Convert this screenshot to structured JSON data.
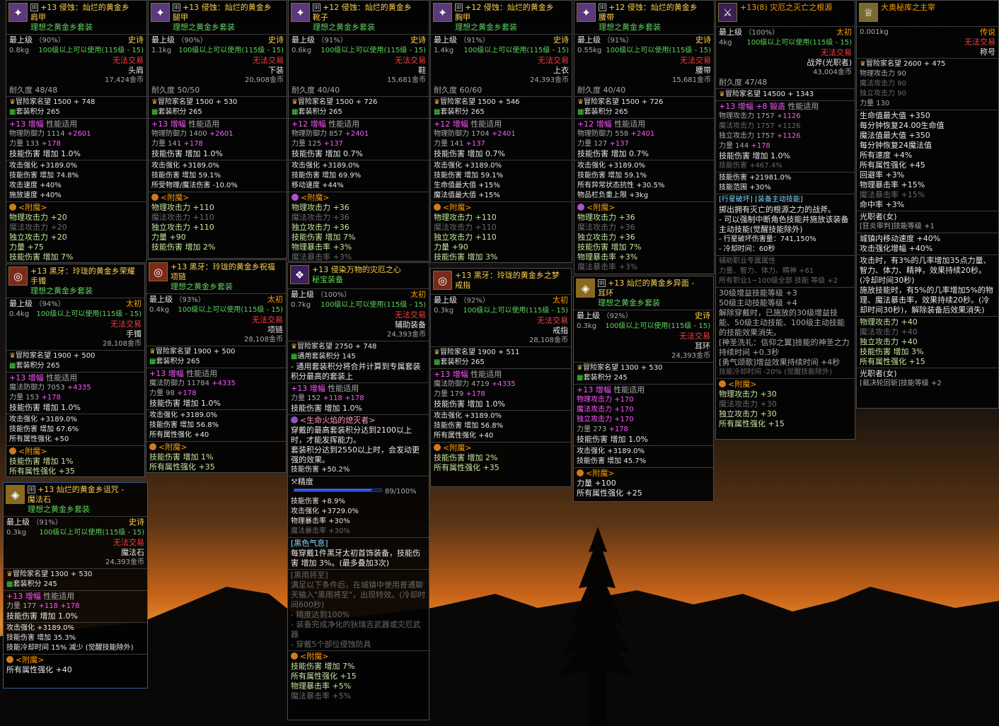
{
  "colors": {
    "epic": "#ffd24a",
    "legend": "#ff9d00",
    "set": "#5fd35f",
    "amp": "#ff55ff",
    "untradeable": "#ff3b3b",
    "sky_top": "#0d0d0f",
    "horizon": "#d9781a"
  },
  "t1": {
    "icon": "shoulder-armor-icon",
    "prefix": "+13 侵蚀：灿烂的黄金乡",
    "name": "肩甲",
    "set": "理想之黄金乡套装",
    "max": "最上级",
    "pct": "（90%）",
    "rarity": "史诗",
    "wt": "0.8kg",
    "req": "100级以上可以使用(115级 - 15)",
    "trade": "无法交易",
    "slot": "头肩",
    "price": "17,424金币",
    "dur": "耐久度 48/48",
    "fame": "冒险家名望 1500 + 748",
    "setscore": "套装积分 265",
    "amp_lv": "+13",
    "amp": "增幅",
    "amp_type": "性能适用",
    "a1": "物理防御力 1114",
    "a1b": "+2601",
    "a2": "力量 133",
    "a2b": "+178",
    "a3": "技能伤害 增加 1.0%",
    "b1": "攻击强化 +3189.0%",
    "b2": "技能伤害 增加 74.8%",
    "b3": "攻击速度 +40%",
    "b4": "施放速度 +40%",
    "ench": "<附魔>",
    "e1": "物理攻击力 +20",
    "e2": "魔法攻击力 +20",
    "e3": "独立攻击力 +20",
    "e4": "力量 +75",
    "e5": "技能伤害 增加 7%"
  },
  "t2": {
    "icon": "leg-armor-icon",
    "prefix": "+13 侵蚀：灿烂的黄金乡",
    "name": "腿甲",
    "set": "理想之黄金乡套装",
    "max": "最上级",
    "pct": "（90%）",
    "rarity": "史诗",
    "wt": "1.1kg",
    "req": "100级以上可以使用(115级 - 15)",
    "trade": "无法交易",
    "slot": "下装",
    "price": "20,908金币",
    "dur": "耐久度 50/50",
    "fame": "冒险家名望 1500 + 530",
    "setscore": "套装积分 265",
    "amp_lv": "+13",
    "amp": "增幅",
    "amp_type": "性能适用",
    "a1": "物理防御力 1400",
    "a1b": "+2601",
    "a2": "力量 141",
    "a2b": "+178",
    "a3": "技能伤害 增加 1.0%",
    "b1": "攻击强化 +3189.0%",
    "b2": "技能伤害 增加 59.1%",
    "b3": "所受物理/魔法伤害 -10.0%",
    "ench": "<附魔>",
    "e1": "物理攻击力 +110",
    "e2": "魔法攻击力 +110",
    "e3": "独立攻击力 +110",
    "e4": "力量 +90",
    "e5": "技能伤害 增加 2%"
  },
  "t3": {
    "icon": "shoes-icon",
    "prefix": "+12 侵蚀：灿烂的黄金乡",
    "name": "靴子",
    "set": "理想之黄金乡套装",
    "max": "最上级",
    "pct": "（91%）",
    "rarity": "史诗",
    "wt": "0.6kg",
    "req": "100级以上可以使用(115级 - 15)",
    "trade": "无法交易",
    "slot": "鞋",
    "price": "15,681金币",
    "dur": "耐久度 40/40",
    "fame": "冒险家名望 1500 + 726",
    "setscore": "套装积分 265",
    "amp_lv": "+12",
    "amp": "增幅",
    "amp_type": "性能适用",
    "a1": "物理防御力 857",
    "a1b": "+2401",
    "a2": "力量 125",
    "a2b": "+137",
    "a3": "技能伤害 增加 0.7%",
    "b1": "攻击强化 +3189.0%",
    "b2": "技能伤害 增加 69.9%",
    "b3": "移动速度 +44%",
    "ench": "<附魔>",
    "e1": "物理攻击力 +36",
    "e2": "魔法攻击力 +36",
    "e3": "独立攻击力 +36",
    "e4": "技能伤害 增加 7%",
    "e5": "物理暴击率 +3%",
    "e6": "魔法暴击率 +3%"
  },
  "t4": {
    "icon": "chest-armor-icon",
    "prefix": "+12 侵蚀：灿烂的黄金乡",
    "name": "胸甲",
    "set": "理想之黄金乡套装",
    "max": "最上级",
    "pct": "（91%）",
    "rarity": "史诗",
    "wt": "1.4kg",
    "req": "100级以上可以使用(115级 - 15)",
    "trade": "无法交易",
    "slot": "上衣",
    "price": "24,393金币",
    "dur": "耐久度 60/60",
    "fame": "冒险家名望 1500 + 546",
    "setscore": "套装积分 265",
    "amp_lv": "+12",
    "amp": "增幅",
    "amp_type": "性能适用",
    "a1": "物理防御力 1704",
    "a1b": "+2401",
    "a2": "力量 141",
    "a2b": "+137",
    "a3": "技能伤害 增加 0.7%",
    "b1": "攻击强化 +3189.0%",
    "b2": "技能伤害 增加 59.1%",
    "b3": "生命值最大值 +15%",
    "b4": "魔法值最大值 +15%",
    "ench": "<附魔>",
    "e1": "物理攻击力 +110",
    "e2": "魔法攻击力 +110",
    "e3": "独立攻击力 +110",
    "e4": "力量 +90",
    "e5": "技能伤害 增加 3%"
  },
  "t5": {
    "icon": "belt-icon",
    "prefix": "+12 侵蚀：灿烂的黄金乡",
    "name": "腰带",
    "set": "理想之黄金乡套装",
    "max": "最上级",
    "pct": "（91%）",
    "rarity": "史诗",
    "wt": "0.55kg",
    "req": "100级以上可以使用(115级 - 15)",
    "trade": "无法交易",
    "slot": "腰带",
    "price": "15,681金币",
    "dur": "耐久度 40/40",
    "fame": "冒险家名望 1500 + 726",
    "setscore": "套装积分 265",
    "amp_lv": "+12",
    "amp": "增幅",
    "amp_type": "性能适用",
    "a1": "物理防御力 558",
    "a1b": "+2401",
    "a2": "力量 127",
    "a2b": "+137",
    "a3": "技能伤害 增加 0.7%",
    "b1": "攻击强化 +3189.0%",
    "b2": "技能伤害 增加 59.1%",
    "b3": "所有异常状态抗性 +30.5%",
    "b4": "物品栏负重上限 +3kg",
    "ench": "<附魔>",
    "e1": "物理攻击力 +36",
    "e2": "魔法攻击力 +36",
    "e3": "独立攻击力 +36",
    "e4": "技能伤害 增加 7%",
    "e5": "物理暴击率 +3%",
    "e6": "魔法暴击率 +3%"
  },
  "t6": {
    "icon": "weapon-icon",
    "name": "+13(8) 灾厄之灭亡之根源",
    "max": "最上级",
    "pct": "（100%）",
    "rarity": "太初",
    "wt": "4kg",
    "req": "100级以上可以使用(115级 - 15)",
    "trade": "无法交易",
    "slot": "战斧(光职者)",
    "price": "43,004金币",
    "dur": "耐久度 47/48",
    "fame": "冒险家名望 14500 + 1343",
    "forge_lv": "+13",
    "forge_lbl": "增幅",
    "forge2": "+8 锻造",
    "forge_type": "性能适用",
    "a1": "物理攻击力 1757",
    "a1b": "+1126",
    "a2": "魔法攻击力 1757",
    "a2b": "+1126",
    "a3": "独立攻击力 1757",
    "a3b": "+1126",
    "a4": "力量 144",
    "a4b": "+178",
    "a5": "技能伤害 增加 1.0%",
    "a6": "技能伤害 +467.4%",
    "b1": "技能伤害 +21981.0%",
    "b2": "技能范围 +30%",
    "skill_title": "[行星破坏] [装备主动技能]",
    "skill_desc": "掷出拥有灭亡的根源之力的战斧。",
    "skill_l1": "- 可以强制中断角色技能并施放该装备主动技能(觉醒技能除外)",
    "skill_l2": "- 行星破坏伤害量：741,150%",
    "skill_l3": "- 冷却时间：60秒",
    "aux": "辅助职业专属属性",
    "aux1": "力量、智力、体力、精神 +61",
    "aux2": "所有职业1~100级全部 技能 等级 +2",
    "x1": "30级增益技能等级 +3",
    "x2": "50级主动技能等级 +4",
    "x3": "解除穿戴时，已施放的30级增益技能、50级主动技能、100级主动技能的技能效果消失。",
    "x4": "[神圣洗礼：信仰之翼]技能的神圣之力持续时间 +0.3秒",
    "x5": "[勇气颂歌]增益效果持续时间 +4秒",
    "x6": "技能冷却时间 -20% (觉醒技能除外)",
    "ench": "<附魔>",
    "e1": "物理攻击力 +30",
    "e2": "魔法攻击力 +30",
    "e3": "独立攻击力 +30",
    "e4": "所有属性强化 +15"
  },
  "t7": {
    "icon": "title-icon",
    "name": "大奥秘库之主宰",
    "rarity": "传说",
    "wt": "0.001kg",
    "trade": "无法交易",
    "slot": "称号",
    "fame": "冒险家名望 2600 + 475",
    "s1": "物理攻击力 90",
    "s2": "魔法攻击力 90",
    "s3": "独立攻击力 90",
    "s4": "力量 130",
    "o1": "生命值最大值 +350",
    "o2": "每分钟恢复24.00生命值",
    "o3": "魔法值最大值 +350",
    "o4": "每分钟恢复24魔法值",
    "o5": "所有速度 +4%",
    "o6": "所有属性强化 +45",
    "o7": "回避率 +3%",
    "o8": "物理暴击率 +15%",
    "o9": "魔法暴击率 +15%",
    "o10": "命中率 +3%",
    "job": "光职者(女)",
    "job_skill": "[狂炎审判]技能等级 +1",
    "town": "城镇内移动速度 +40%",
    "atkspd": "攻击强化增幅 +40%",
    "p1": "攻击时，有3%的几率增加35点力量、智力、体力、精神，效果持续20秒。(冷却时间30秒)",
    "p2": "施放技能时，有5%的几率增加5%的物理、魔法暴击率，效果持续20秒。(冷却时间30秒)，解除装备后效果消失)",
    "g1": "物理攻击力 +40",
    "g2": "魔法攻击力 +40",
    "g3": "独立攻击力 +40",
    "g4": "技能伤害 增加 3%",
    "g5": "所有属性强化 +15",
    "job2": "光职者(女)",
    "job2_skill": "[裁决轮回斩]技能等级 +2"
  },
  "t8": {
    "icon": "bracelet-icon",
    "prefix": "+13 黑牙：玲珑的黄金乡荣耀",
    "name": "手镯",
    "set": "理想之黄金乡套装",
    "max": "最上级",
    "pct": "（94%）",
    "rarity": "太初",
    "wt": "0.4kg",
    "req": "100级以上可以使用(115级 - 15)",
    "trade": "无法交易",
    "slot": "手镯",
    "price": "28,108金币",
    "fame": "冒险家名望 1900 + 500",
    "setscore": "套装积分 265",
    "amp_lv": "+13",
    "amp": "增幅",
    "amp_type": "性能适用",
    "a1": "魔法防御力 7053",
    "a1b": "+4335",
    "a2": "力量 153",
    "a2b": "+178",
    "a3": "技能伤害 增加 1.0%",
    "b1": "攻击强化 +3189.0%",
    "b2": "技能伤害 增加 67.6%",
    "b3": "所有属性强化 +50",
    "ench": "<附魔>",
    "e1": "技能伤害 增加 1%",
    "e2": "所有属性强化 +35"
  },
  "t9": {
    "icon": "necklace-icon",
    "prefix": "+13 黑牙：玲珑的黄金乡祝福",
    "name": "项链",
    "set": "理想之黄金乡套装",
    "max": "最上级",
    "pct": "（93%）",
    "rarity": "太初",
    "wt": "0.4kg",
    "req": "100级以上可以使用(115级 - 15)",
    "trade": "无法交易",
    "slot": "项链",
    "price": "28,108金币",
    "fame": "冒险家名望 1900 + 500",
    "setscore": "套装积分 265",
    "amp_lv": "+13",
    "amp": "增幅",
    "amp_type": "性能适用",
    "a1": "魔法防御力 11784",
    "a1b": "+4335",
    "a2": "力量 98",
    "a2b": "+178",
    "a3": "技能伤害 增加 1.0%",
    "b1": "攻击强化 +3189.0%",
    "b2": "技能伤害 增加 56.8%",
    "b3": "所有属性强化 +40",
    "ench": "<附魔>",
    "e1": "技能伤害 增加 1%",
    "e2": "所有属性强化 +35"
  },
  "t10": {
    "icon": "support-gem-icon",
    "prefix": "+13 侵染万物的灾厄之心",
    "name": "秘宝装备",
    "max": "最上级",
    "pct": "（100%）",
    "rarity": "太初",
    "wt": "0.7kg",
    "req": "100级以上可以使用(115级 - 15)",
    "trade": "无法交易",
    "slot": "辅助装备",
    "price": "24,393金币",
    "fame": "冒险家名望 2750 + 748",
    "setscore": "通用套装积分 145",
    "n1": "- 通用套装积分将合并计算到专属套装积分最高的套装上",
    "amp_lv": "+13",
    "amp": "增幅",
    "amp_type": "性能适用",
    "a1": "力量 152",
    "a1b": "+118",
    "a1c": "+178",
    "a2": "技能伤害 增加 1.0%",
    "life_title": "<生命火焰的熄灭者>",
    "life1": "穿戴的最高套装积分达到2100以上时，才能发挥能力。",
    "life2": "套装积分达到2550以上时，会发动更强的效果。",
    "life3": "技能伤害 +50.2%",
    "prec": "精度",
    "prec_pct": "89/100%",
    "prec_val": 89,
    "c1": "技能伤害 +8.9%",
    "c2": "攻击强化 +3729.0%",
    "c3": "物理暴击率 +30%",
    "c4": "魔法暴击率 +30%",
    "black_title": "[黑色气息]",
    "black1": "每穿戴1件黑牙太初首饰装备，技能伤害 增加 3%。(最多叠加3次)",
    "rain_title": "[黑雨将至]",
    "rain1": "满足以下条件后，在城镇中使用普通聊天输入\"黑雨将至\"，出现特效。(冷却时间600秒)",
    "rain2": "- 精度达到100%",
    "rain3": "- 装备完成净化的狄瑞吉武器或灾厄武器",
    "rain4": "- 穿戴5个部位侵蚀防具",
    "ench": "<附魔>",
    "e1": "技能伤害 增加 7%",
    "e2": "所有属性强化 +15",
    "e3": "物理暴击率 +5%",
    "e4": "魔法暴击率 +5%"
  },
  "t11": {
    "icon": "ring-icon",
    "prefix": "+13 黑牙：玲珑的黄金乡之梦",
    "name": "戒指",
    "set": "理想之黄金乡套装",
    "max": "最上级",
    "pct": "（92%）",
    "rarity": "太初",
    "wt": "0.3kg",
    "req": "100级以上可以使用(115级 - 15)",
    "trade": "无法交易",
    "slot": "戒指",
    "price": "28,108金币",
    "fame": "冒险家名望 1900 + 511",
    "setscore": "套装积分 265",
    "amp_lv": "+13",
    "amp": "增幅",
    "amp_type": "性能适用",
    "a1": "魔法防御力 4719",
    "a1b": "+4335",
    "a2": "力量 179",
    "a2b": "+178",
    "a3": "技能伤害 增加 1.0%",
    "b1": "攻击强化 +3189.0%",
    "b2": "技能伤害 增加 56.8%",
    "b3": "所有属性强化 +40",
    "ench": "<附魔>",
    "e1": "技能伤害 增加 2%",
    "e2": "所有属性强化 +35"
  },
  "t12": {
    "icon": "earring-icon",
    "prefix": "+13 灿烂的黄金乡异面 -",
    "name": "耳环",
    "set": "理想之黄金乡套装",
    "max": "最上级",
    "pct": "（92%）",
    "rarity": "史诗",
    "wt": "0.3kg",
    "req": "100级以上可以使用(115级 - 15)",
    "trade": "无法交易",
    "slot": "耳环",
    "price": "24,393金币",
    "fame": "冒险家名望 1300 + 530",
    "setscore": "套装积分 245",
    "amp_lv": "+13",
    "amp": "增幅",
    "amp_type": "性能适用",
    "a1": "物理攻击力 +170",
    "a2": "魔法攻击力 +170",
    "a3": "独立攻击力 +170",
    "a4": "力量 273",
    "a4b": "+178",
    "a5": "技能伤害 增加 1.0%",
    "b1": "攻击强化 +3189.0%",
    "b2": "技能伤害 增加 45.7%",
    "ench": "<附魔>",
    "e1": "力量 +100",
    "e2": "所有属性强化 +25"
  },
  "t13": {
    "icon": "magic-stone-icon",
    "prefix": "+13 灿烂的黄金乡诅咒 -",
    "name": "魔法石",
    "set": "理想之黄金乡套装",
    "max": "最上级",
    "pct": "（91%）",
    "rarity": "史诗",
    "wt": "0.3kg",
    "req": "100级以上可以使用(115级 - 15)",
    "trade": "无法交易",
    "slot": "魔法石",
    "price": "24,393金币",
    "fame": "冒险家名望 1300 + 530",
    "setscore": "套装积分 245",
    "amp_lv": "+13",
    "amp": "增幅",
    "amp_type": "性能适用",
    "a1": "力量 177",
    "a1b": "+118",
    "a1c": "+178",
    "a2": "技能伤害 增加 1.0%",
    "b1": "攻击强化 +3189.0%",
    "b2": "技能伤害 增加 35.3%",
    "b3": "技能冷却时间 15% 减少 (觉醒技能除外)",
    "ench": "<附魔>",
    "e1": "所有属性强化 +40"
  }
}
